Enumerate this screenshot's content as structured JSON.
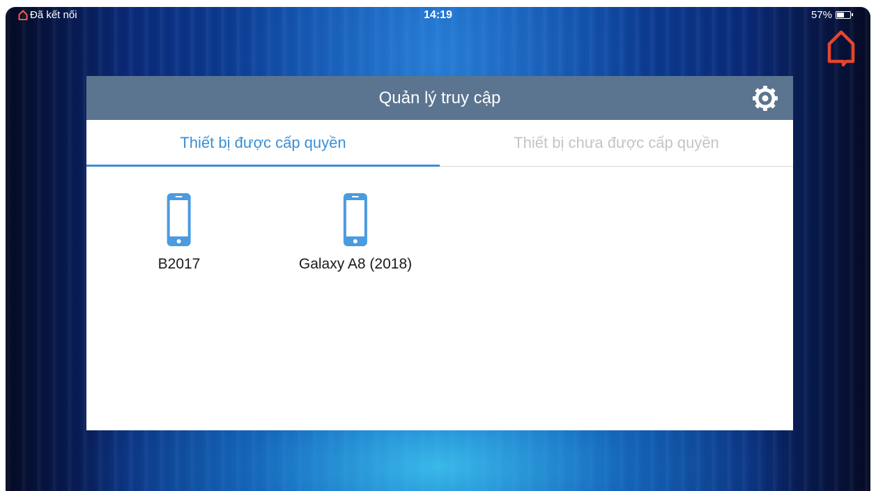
{
  "status_bar": {
    "connection_label": "Đã kết nối",
    "time": "14:19",
    "battery_percent": "57%",
    "battery_level": 0.57,
    "icons": [
      "home-outline-icon",
      "battery-icon"
    ]
  },
  "colors": {
    "accent": "#3a8fd6",
    "header_bg": "#5b7590",
    "home_icon": "#e8452c",
    "device_icon": "#4a9be0"
  },
  "panel": {
    "title": "Quản lý truy cập",
    "settings_icon": "gear-icon",
    "tabs": [
      {
        "label": "Thiết bị được cấp quyền",
        "active": true
      },
      {
        "label": "Thiết bị chưa được cấp quyền",
        "active": false
      }
    ],
    "devices": [
      {
        "name": "B2017",
        "icon": "smartphone-icon"
      },
      {
        "name": "Galaxy A8 (2018)",
        "icon": "smartphone-icon"
      }
    ]
  }
}
